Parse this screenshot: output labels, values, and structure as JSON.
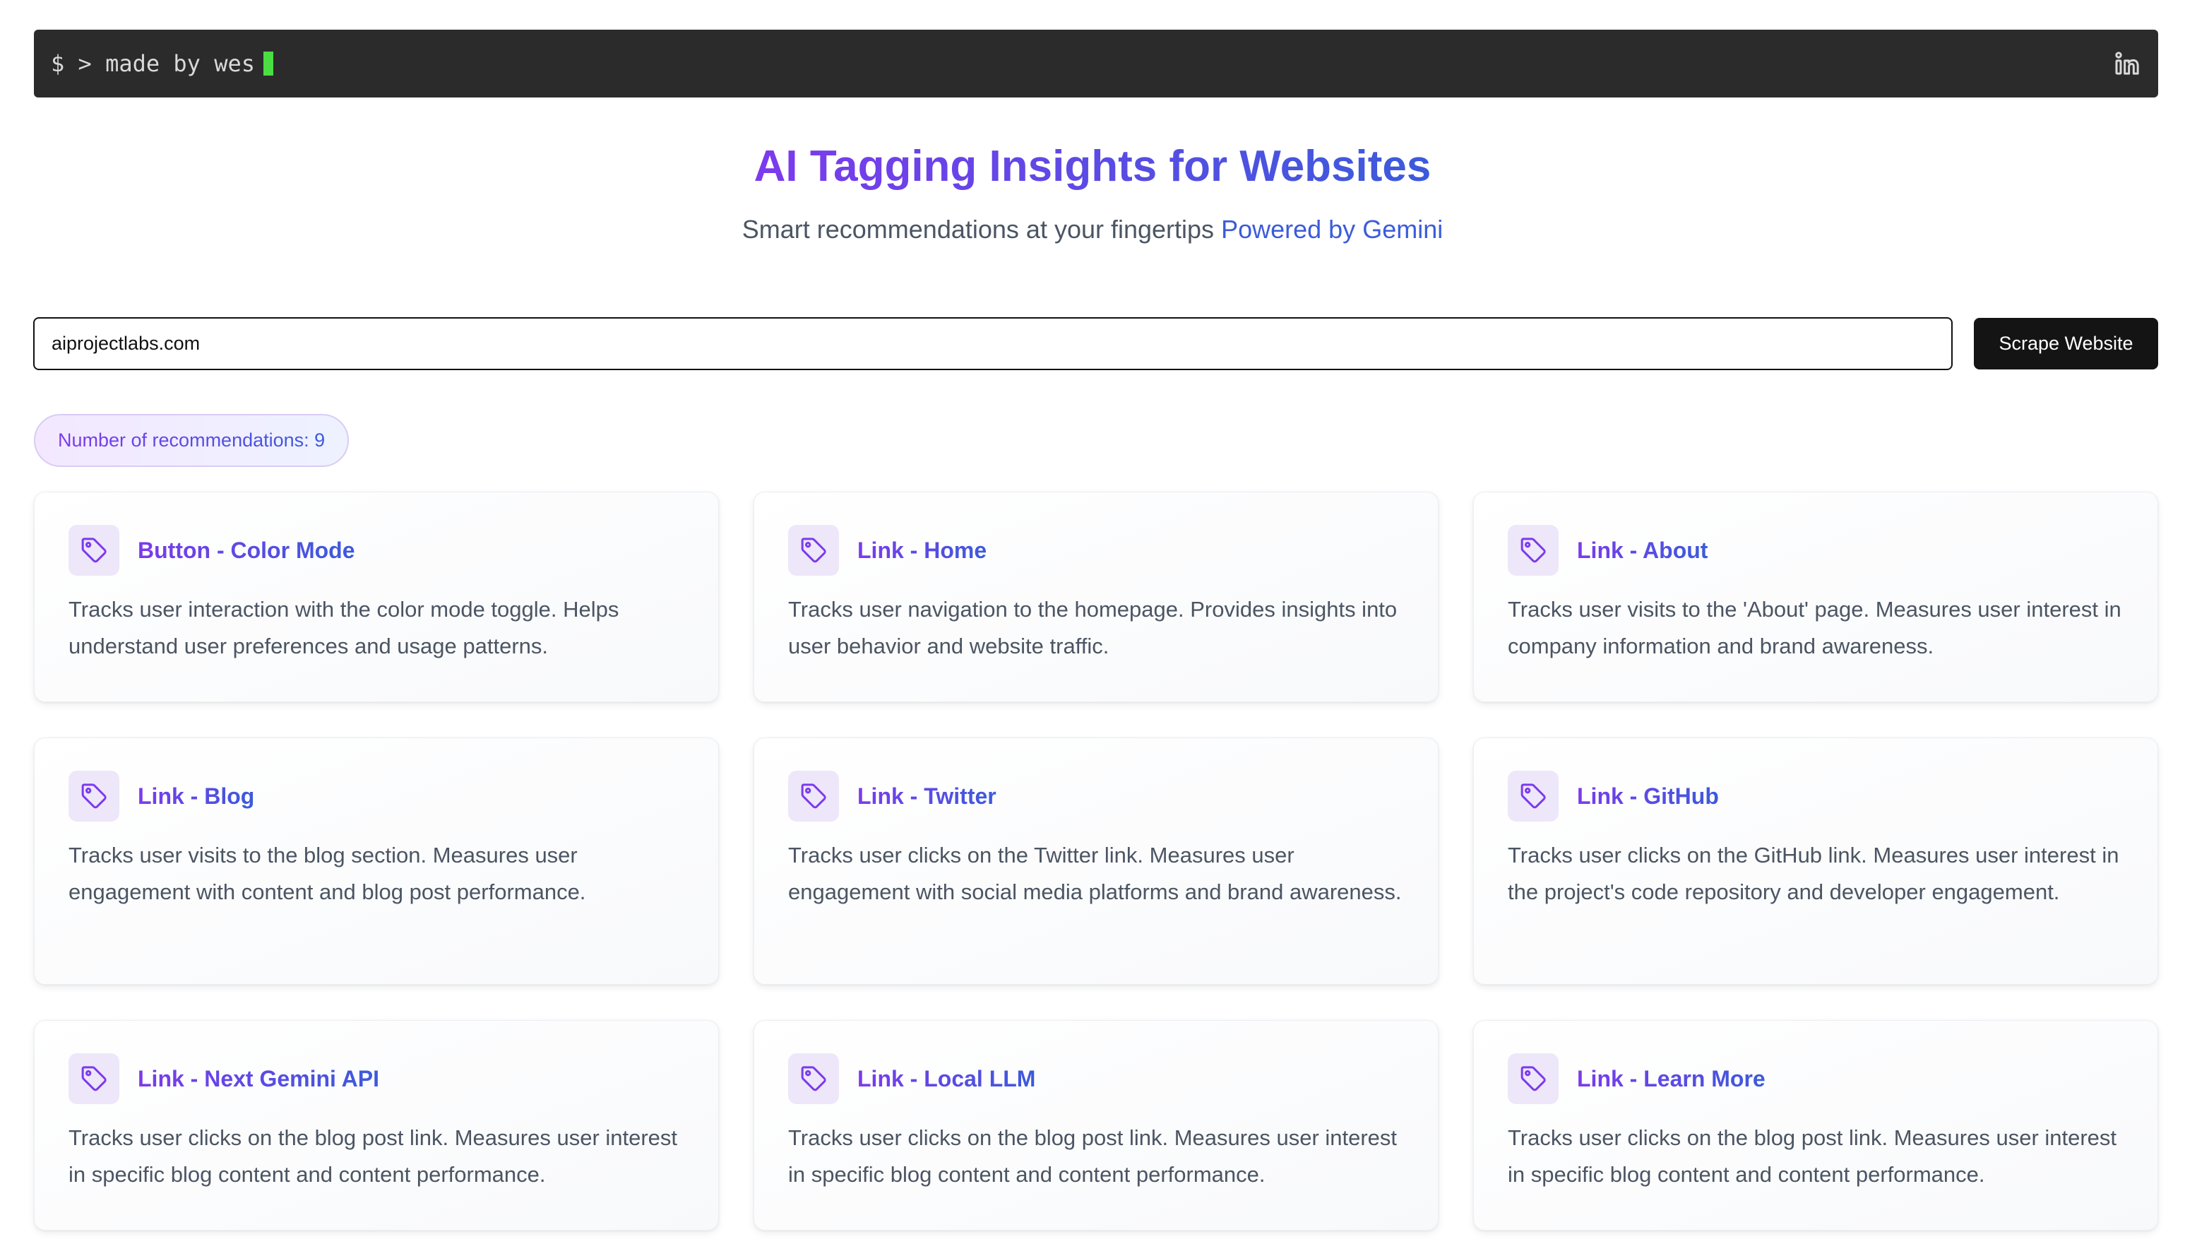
{
  "header": {
    "terminal_text": "$ > made by wes",
    "cursor_color": "#4ade42",
    "social_icon": "linkedin-icon"
  },
  "hero": {
    "title": "AI Tagging Insights for Websites",
    "subtitle": "Smart recommendations at your fingertips",
    "powered_by": "Powered by Gemini"
  },
  "search": {
    "url_value": "aiprojectlabs.com",
    "button_label": "Scrape Website"
  },
  "summary": {
    "badge_text": "Number of recommendations: 9"
  },
  "colors": {
    "accent_purple": "#7c3aed",
    "accent_blue": "#3b5bdb",
    "topbar_bg": "#2b2b2b",
    "button_bg": "#141414"
  },
  "recommendations": [
    {
      "title": "Button - Color Mode",
      "icon": "tag-icon",
      "description": "Tracks user interaction with the color mode toggle. Helps understand user preferences and usage patterns."
    },
    {
      "title": "Link - Home",
      "icon": "tag-icon",
      "description": "Tracks user navigation to the homepage. Provides insights into user behavior and website traffic."
    },
    {
      "title": "Link - About",
      "icon": "tag-icon",
      "description": "Tracks user visits to the 'About' page. Measures user interest in company information and brand awareness."
    },
    {
      "title": "Link - Blog",
      "icon": "tag-icon",
      "description": "Tracks user visits to the blog section. Measures user engagement with content and blog post performance."
    },
    {
      "title": "Link - Twitter",
      "icon": "tag-icon",
      "description": "Tracks user clicks on the Twitter link. Measures user engagement with social media platforms and brand awareness."
    },
    {
      "title": "Link - GitHub",
      "icon": "tag-icon",
      "description": "Tracks user clicks on the GitHub link. Measures user interest in the project's code repository and developer engagement."
    },
    {
      "title": "Link - Next Gemini API",
      "icon": "tag-icon",
      "description": "Tracks user clicks on the blog post link. Measures user interest in specific blog content and content performance."
    },
    {
      "title": "Link - Local LLM",
      "icon": "tag-icon",
      "description": "Tracks user clicks on the blog post link. Measures user interest in specific blog content and content performance."
    },
    {
      "title": "Link - Learn More",
      "icon": "tag-icon",
      "description": "Tracks user clicks on the blog post link. Measures user interest in specific blog content and content performance."
    }
  ]
}
